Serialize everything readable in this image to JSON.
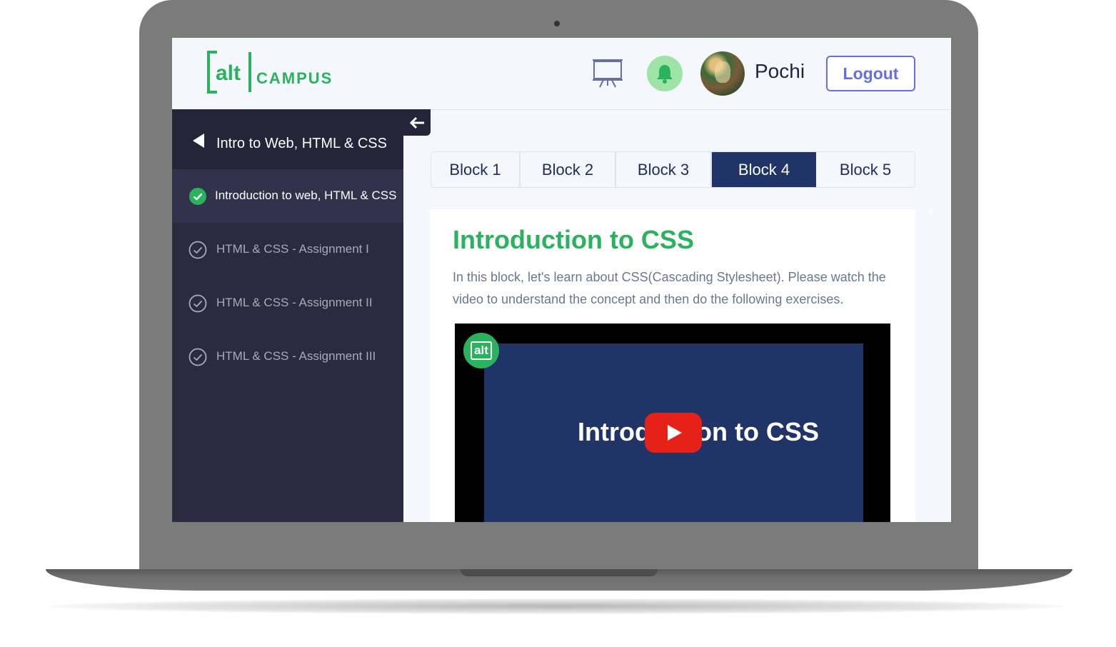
{
  "header": {
    "logo_alt": "alt",
    "logo_campus": "CAMPUS",
    "username": "Pochi",
    "logout_label": "Logout",
    "icons": [
      "presentation-board-icon",
      "bell-icon"
    ]
  },
  "sidebar": {
    "title": "Intro to Web, HTML & CSS",
    "items": [
      {
        "label": "Introduction to web,  HTML & CSS",
        "completed": true,
        "active": true
      },
      {
        "label": "HTML & CSS - Assignment I",
        "completed": false,
        "active": false
      },
      {
        "label": "HTML & CSS - Assignment II",
        "completed": false,
        "active": false
      },
      {
        "label": "HTML & CSS - Assignment III",
        "completed": false,
        "active": false
      }
    ]
  },
  "tabs": [
    {
      "label": "Block 1",
      "active": false
    },
    {
      "label": "Block 2",
      "active": false
    },
    {
      "label": "Block 3",
      "active": false
    },
    {
      "label": "Block 4",
      "active": true
    },
    {
      "label": "Block 5",
      "active": false
    }
  ],
  "content": {
    "title": "Introduction to CSS",
    "description": "In this block, let's learn about CSS(Cascading Stylesheet). Please watch the video to understand the concept and then do the following exercises.",
    "video": {
      "logo_text": "alt",
      "title": "Introduction to CSS"
    }
  },
  "colors": {
    "accent_green": "#2ab25e",
    "navy": "#213467",
    "sidebar_bg": "#2a2a40",
    "logout_purple": "#6670dc",
    "youtube_red": "#e62117"
  }
}
